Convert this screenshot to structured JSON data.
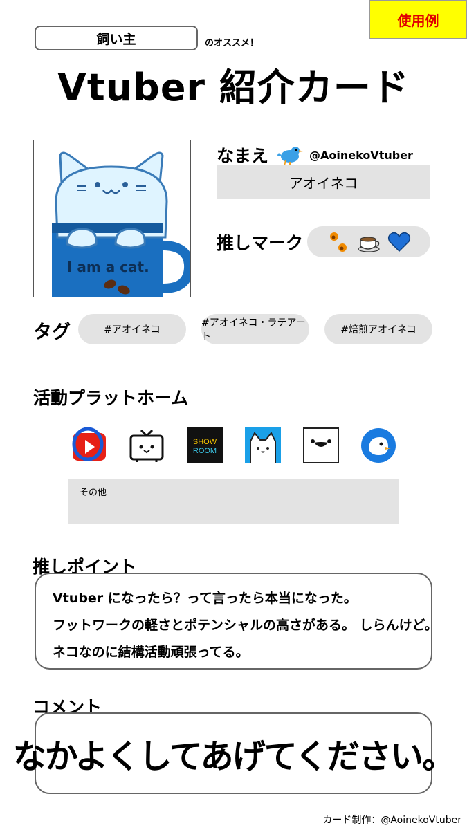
{
  "badge": "使用例",
  "owner_box": "飼い主",
  "recommend_suffix": "のオススメ！",
  "title": "Vtuber 紹介カード",
  "avatar": {
    "text": "I am a cat."
  },
  "name": {
    "label": "なまえ",
    "twitter_handle": "@AoinekoVtuber",
    "value": "アオイネコ",
    "icon": "twitter-bird-icon"
  },
  "oshi_mark": {
    "label": "推しマーク",
    "icons": [
      "paw-icon",
      "coffee-cup-icon",
      "blue-heart-icon"
    ]
  },
  "tags": {
    "label": "タグ",
    "items": [
      "#アオイネコ",
      "#アオイネコ・ラテアート",
      "#焙煎アオイネコ"
    ]
  },
  "platforms": {
    "label": "活動プラットホーム",
    "icons": [
      "youtube-icon",
      "niconico-icon",
      "showroom-icon",
      "cat-app-icon",
      "face-app-icon",
      "bird-app-icon"
    ],
    "showroom_text": [
      "SHOW",
      "ROOM"
    ],
    "other_label": "その他"
  },
  "point": {
    "label": "推しポイント",
    "lines": [
      "Vtuber になったら？って言ったら本当になった。",
      "フットワークの軽さとポテンシャルの高さがある。 しらんけど。",
      "ネコなのに結構活動頑張ってる。"
    ]
  },
  "comment": {
    "label": "コメント",
    "text": "なかよくしてあげてください。"
  },
  "credit": "カード制作：@AoinekoVtuber",
  "colors": {
    "badge_bg": "#ffff00",
    "badge_text": "#e00000",
    "mug": "#1a6fc0",
    "cat": "#dff4ff",
    "box_gray": "#e3e3e3"
  }
}
